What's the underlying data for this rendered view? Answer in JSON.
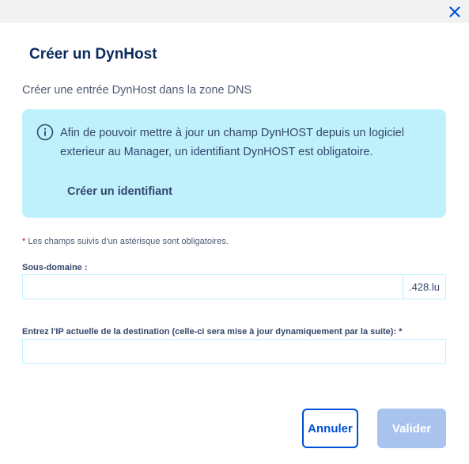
{
  "dialog": {
    "title": "Créer un DynHost",
    "subtitle": "Créer une entrée DynHost dans la zone DNS"
  },
  "info": {
    "icon": "info-circle-icon",
    "text": "Afin de pouvoir mettre à jour un champ DynHOST depuis un logiciel exterieur au Manager, un identifiant DynHOST est obligatoire.",
    "link_label": "Créer un identifiant"
  },
  "form": {
    "required_star": "*",
    "required_note": "Les champs suivis d'un astérisque sont obligatoires.",
    "subdomain": {
      "label": "Sous-domaine :",
      "value": "",
      "suffix": ".428.lu"
    },
    "ip": {
      "label": "Entrez l'IP actuelle de la destination (celle-ci sera mise à jour dynamiquement par la suite):  *",
      "value": ""
    }
  },
  "actions": {
    "cancel_label": "Annuler",
    "submit_label": "Valider"
  },
  "colors": {
    "primary": "#0050d7",
    "title": "#0a2a5e",
    "info_bg": "#bff1fc",
    "disabled_button": "#a8c4ee",
    "required": "#e0001a"
  }
}
